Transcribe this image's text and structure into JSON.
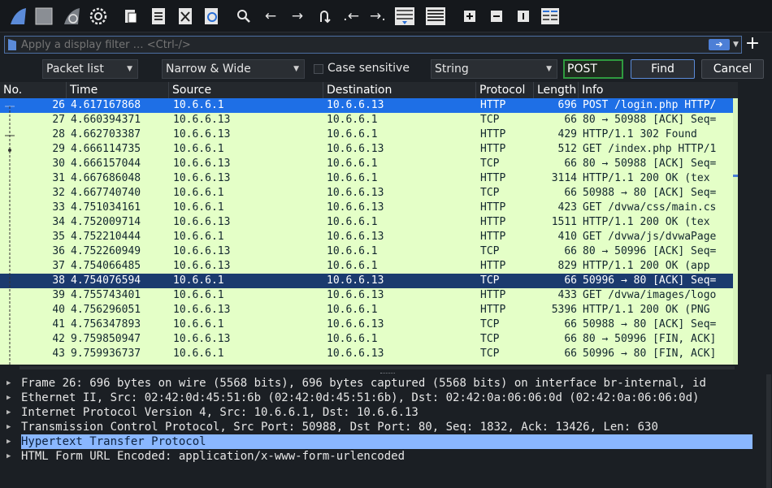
{
  "toolbar": {
    "icons": [
      "shark-fin-icon",
      "stop-square-icon",
      "restart-fin-icon",
      "gear-icon",
      "open-file-icon",
      "save-file-icon",
      "close-file-icon",
      "reload-icon",
      "search-icon",
      "arrow-left-icon",
      "arrow-right-icon",
      "jump-icon",
      "first-packet-icon",
      "last-packet-icon",
      "autoscroll-icon",
      "colorize-icon",
      "zoom-in-icon",
      "zoom-out-icon",
      "zoom-normal-icon",
      "resize-columns-icon"
    ]
  },
  "filter": {
    "placeholder": "Apply a display filter … <Ctrl-/>"
  },
  "find": {
    "scope": "Packet list",
    "charset": "Narrow & Wide",
    "case_label": "Case sensitive",
    "type": "String",
    "search_value": "POST",
    "find_label": "Find",
    "cancel_label": "Cancel"
  },
  "columns": [
    "No.",
    "Time",
    "Source",
    "Destination",
    "Protocol",
    "Length",
    "Info"
  ],
  "packets": [
    {
      "no": "26",
      "time": "4.617167868",
      "src": "10.6.6.1",
      "dst": "10.6.6.13",
      "proto": "HTTP",
      "len": "696",
      "info": "POST /login.php HTTP/",
      "state": "sel"
    },
    {
      "no": "27",
      "time": "4.660394371",
      "src": "10.6.6.13",
      "dst": "10.6.6.1",
      "proto": "TCP",
      "len": "66",
      "info": "80 → 50988 [ACK] Seq=",
      "state": ""
    },
    {
      "no": "28",
      "time": "4.662703387",
      "src": "10.6.6.13",
      "dst": "10.6.6.1",
      "proto": "HTTP",
      "len": "429",
      "info": "HTTP/1.1 302 Found",
      "state": ""
    },
    {
      "no": "29",
      "time": "4.666114735",
      "src": "10.6.6.1",
      "dst": "10.6.6.13",
      "proto": "HTTP",
      "len": "512",
      "info": "GET /index.php HTTP/1",
      "state": ""
    },
    {
      "no": "30",
      "time": "4.666157044",
      "src": "10.6.6.13",
      "dst": "10.6.6.1",
      "proto": "TCP",
      "len": "66",
      "info": "80 → 50988 [ACK] Seq=",
      "state": ""
    },
    {
      "no": "31",
      "time": "4.667686048",
      "src": "10.6.6.13",
      "dst": "10.6.6.1",
      "proto": "HTTP",
      "len": "3114",
      "info": "HTTP/1.1 200 OK  (tex",
      "state": ""
    },
    {
      "no": "32",
      "time": "4.667740740",
      "src": "10.6.6.1",
      "dst": "10.6.6.13",
      "proto": "TCP",
      "len": "66",
      "info": "50988 → 80 [ACK] Seq=",
      "state": ""
    },
    {
      "no": "33",
      "time": "4.751034161",
      "src": "10.6.6.1",
      "dst": "10.6.6.13",
      "proto": "HTTP",
      "len": "423",
      "info": "GET /dvwa/css/main.cs",
      "state": ""
    },
    {
      "no": "34",
      "time": "4.752009714",
      "src": "10.6.6.13",
      "dst": "10.6.6.1",
      "proto": "HTTP",
      "len": "1511",
      "info": "HTTP/1.1 200 OK  (tex",
      "state": ""
    },
    {
      "no": "35",
      "time": "4.752210444",
      "src": "10.6.6.1",
      "dst": "10.6.6.13",
      "proto": "HTTP",
      "len": "410",
      "info": "GET /dvwa/js/dvwaPage",
      "state": ""
    },
    {
      "no": "36",
      "time": "4.752260949",
      "src": "10.6.6.13",
      "dst": "10.6.6.1",
      "proto": "TCP",
      "len": "66",
      "info": "80 → 50996 [ACK] Seq=",
      "state": ""
    },
    {
      "no": "37",
      "time": "4.754066485",
      "src": "10.6.6.13",
      "dst": "10.6.6.1",
      "proto": "HTTP",
      "len": "829",
      "info": "HTTP/1.1 200 OK  (app",
      "state": ""
    },
    {
      "no": "38",
      "time": "4.754076594",
      "src": "10.6.6.1",
      "dst": "10.6.6.13",
      "proto": "TCP",
      "len": "66",
      "info": "50996 → 80 [ACK] Seq=",
      "state": "mark"
    },
    {
      "no": "39",
      "time": "4.755743401",
      "src": "10.6.6.1",
      "dst": "10.6.6.13",
      "proto": "HTTP",
      "len": "433",
      "info": "GET /dvwa/images/logo",
      "state": ""
    },
    {
      "no": "40",
      "time": "4.756296051",
      "src": "10.6.6.13",
      "dst": "10.6.6.1",
      "proto": "HTTP",
      "len": "5396",
      "info": "HTTP/1.1 200 OK  (PNG",
      "state": ""
    },
    {
      "no": "41",
      "time": "4.756347893",
      "src": "10.6.6.1",
      "dst": "10.6.6.13",
      "proto": "TCP",
      "len": "66",
      "info": "50988 → 80 [ACK] Seq=",
      "state": ""
    },
    {
      "no": "42",
      "time": "9.759850947",
      "src": "10.6.6.13",
      "dst": "10.6.6.1",
      "proto": "TCP",
      "len": "66",
      "info": "80 → 50996 [FIN, ACK]",
      "state": ""
    },
    {
      "no": "43",
      "time": "9.759936737",
      "src": "10.6.6.1",
      "dst": "10.6.6.13",
      "proto": "TCP",
      "len": "66",
      "info": "50996 → 80 [FIN, ACK]",
      "state": ""
    }
  ],
  "details": [
    {
      "text": "Frame 26: 696 bytes on wire (5568 bits), 696 bytes captured (5568 bits) on interface br-internal, id",
      "hl": false
    },
    {
      "text": "Ethernet II, Src: 02:42:0d:45:51:6b (02:42:0d:45:51:6b), Dst: 02:42:0a:06:06:0d (02:42:0a:06:06:0d)",
      "hl": false
    },
    {
      "text": "Internet Protocol Version 4, Src: 10.6.6.1, Dst: 10.6.6.13",
      "hl": false
    },
    {
      "text": "Transmission Control Protocol, Src Port: 50988, Dst Port: 80, Seq: 1832, Ack: 13426, Len: 630",
      "hl": false
    },
    {
      "text": "Hypertext Transfer Protocol",
      "hl": true
    },
    {
      "text": "HTML Form URL Encoded: application/x-www-form-urlencoded",
      "hl": false
    }
  ],
  "colors": {
    "row_bg": "#e4ffc7",
    "selected": "#1e6fe6",
    "marked": "#1b3a6e",
    "detail_highlight": "#8ab7ff",
    "search_border": "#2f9a3f"
  }
}
